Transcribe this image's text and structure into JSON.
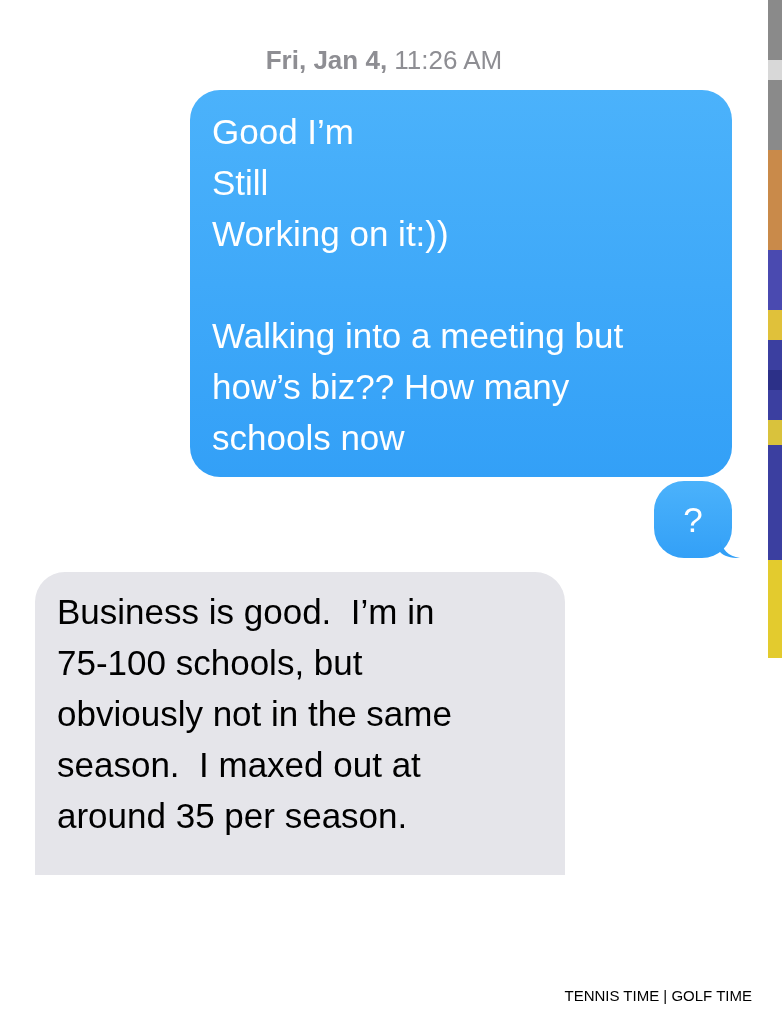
{
  "timestamp": "**Fri, Jan 4,** 11:26 AM",
  "messages": [
    {
      "kind": "outgoing",
      "text": "Good I’m\nStill\nWorking on it:))\n\nWalking into a meeting but\nhow’s biz?? How many\nschools now",
      "tail": false
    },
    {
      "kind": "outgoing",
      "text": "?",
      "tail": true
    },
    {
      "kind": "incoming",
      "text": "Business is good.  I’m in\n75-100 schools, but\nobviously not in the same\nseason.  I maxed out at\naround 35 per season.",
      "tail": false
    }
  ],
  "footer": "TENNIS TIME | GOLF TIME"
}
